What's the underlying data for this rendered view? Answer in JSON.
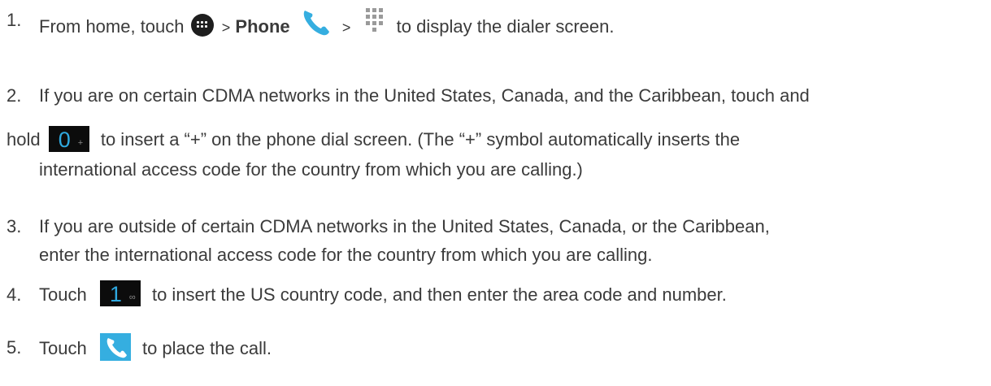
{
  "steps": [
    {
      "number": "1.",
      "pre": "From home, touch",
      "sep1": ">",
      "bold": "Phone",
      "sep2": ">",
      "post": "to display the dialer screen.",
      "icons": [
        "apps-icon",
        "phone-icon",
        "dialpad-icon"
      ]
    },
    {
      "number": "2.",
      "line1": "If you are on certain CDMA networks in the United States, Canada, and the Caribbean, touch and",
      "pre": "hold",
      "post": "to insert a “+” on the phone dial screen. (The “+” symbol automatically inserts the",
      "line3": "international access code for the country from which you are calling.)",
      "key_digit": "0",
      "key_sub": "+",
      "icons": [
        "zero-plus-key-icon"
      ]
    },
    {
      "number": "3.",
      "line1": "If you are outside of certain CDMA networks in the United States, Canada, or the Caribbean,",
      "line2": "enter the international access code for the country from which you are calling."
    },
    {
      "number": "4.",
      "pre": "Touch",
      "post": "to insert the US country code, and then enter the area code and number.",
      "key_digit": "1",
      "key_sub": "∞",
      "icons": [
        "one-voicemail-key-icon"
      ]
    },
    {
      "number": "5.",
      "pre": "Touch",
      "post": "to place the call.",
      "icons": [
        "call-button-icon"
      ]
    }
  ],
  "colors": {
    "text": "#3b3b3b",
    "phone_blue": "#35aee0",
    "key_background": "#0c0c0c",
    "key_digit": "#2fa9e0"
  }
}
